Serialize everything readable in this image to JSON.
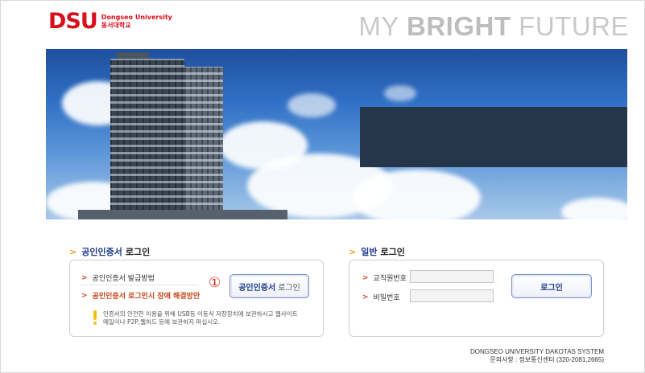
{
  "header": {
    "logo_mark": "DSU",
    "logo_en": "Dongseo University",
    "logo_ko": "동서대학교",
    "tagline_light_1": "MY ",
    "tagline_bold": "BRIGHT",
    "tagline_light_2": " FUTURE"
  },
  "cert_login": {
    "title_highlight": "공인인증서",
    "title_rest": "로그인",
    "link_issue": "공인인증서 발급방법",
    "link_trouble": "공인인증서 로그인시 장애 해결방안",
    "step_marker": "①",
    "button_main": "공인인증서",
    "button_sub": "로그인",
    "notice_line1": "인증서의 안전한 이용을 위해 USB등 이동식 저장장치에 보관하시고 웹사이트",
    "notice_line2": "메일이나 P2P,웹하드 등에 보관하지 마십시오."
  },
  "general_login": {
    "title_highlight": "일반",
    "title_rest": "로그인",
    "id_label": "교직원번호",
    "pw_label": "비밀번호",
    "id_value": "",
    "pw_value": "",
    "button": "로그인"
  },
  "footer": {
    "system": "DONGSEO UNIVERSITY DAKOTAS SYSTEM",
    "contact": "문의사항 : 정보통신센터 (320-2081,2665)"
  },
  "colors": {
    "brand_red": "#d7101b",
    "accent_orange": "#f39a1e",
    "navy": "#1e3a8a",
    "banner_dark_box": "#26364a"
  }
}
